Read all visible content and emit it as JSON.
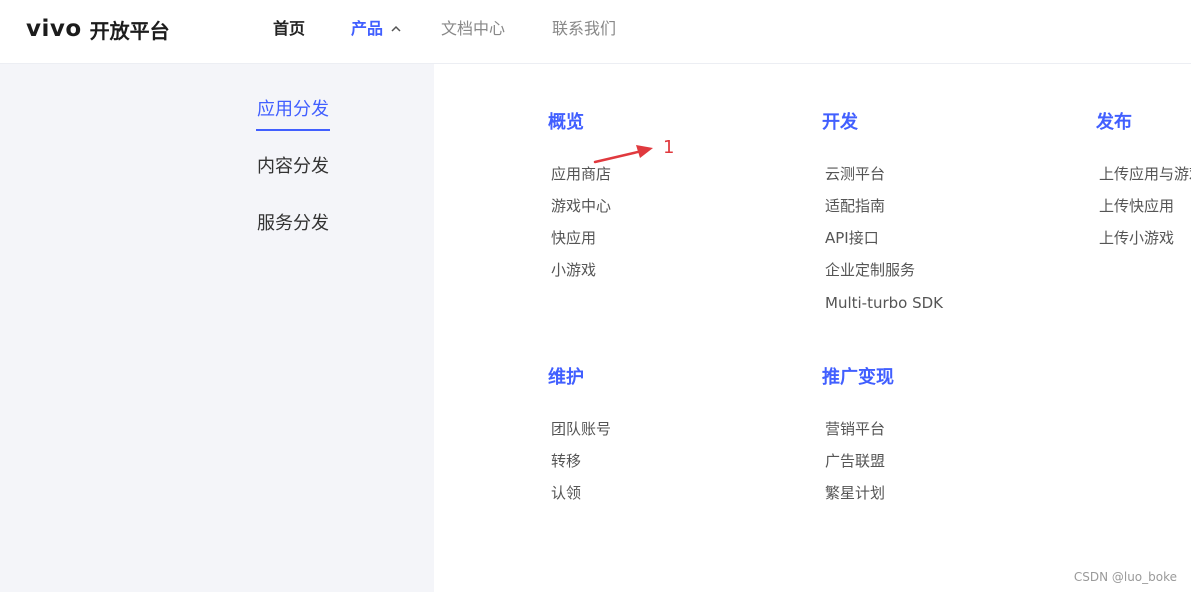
{
  "header": {
    "logo_brand": "vivo",
    "logo_text": "开放平台",
    "nav": {
      "home": "首页",
      "product": "产品",
      "docs": "文档中心",
      "contact": "联系我们"
    }
  },
  "sidebar": {
    "items": [
      "应用分发",
      "内容分发",
      "服务分发"
    ],
    "active_index": 0
  },
  "categories": {
    "overview": {
      "title": "概览",
      "links": [
        "应用商店",
        "游戏中心",
        "快应用",
        "小游戏"
      ]
    },
    "develop": {
      "title": "开发",
      "links": [
        "云测平台",
        "适配指南",
        "API接口",
        "企业定制服务",
        "Multi-turbo SDK"
      ]
    },
    "publish": {
      "title": "发布",
      "links": [
        "上传应用与游戏",
        "上传快应用",
        "上传小游戏"
      ]
    },
    "maintain": {
      "title": "维护",
      "links": [
        "团队账号",
        "转移",
        "认领"
      ]
    },
    "promote": {
      "title": "推广变现",
      "links": [
        "营销平台",
        "广告联盟",
        "繁星计划"
      ]
    }
  },
  "annotation": {
    "label": "1",
    "color": "#e0393e"
  },
  "watermark": "CSDN @luo_boke",
  "colors": {
    "accent": "#415fff",
    "sidebar_bg": "#f4f5f9"
  }
}
